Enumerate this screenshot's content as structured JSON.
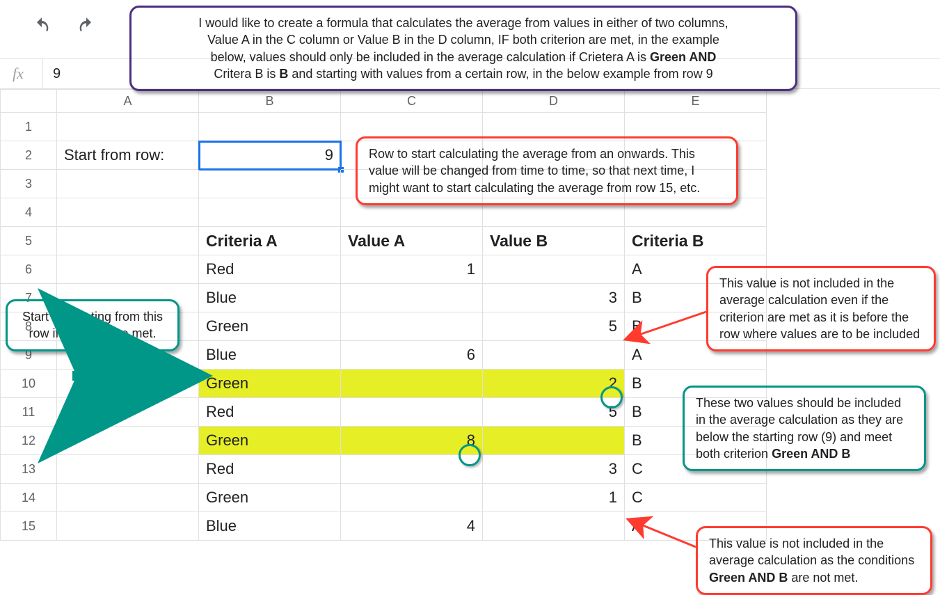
{
  "toolbar": {
    "undo_name": "undo-icon",
    "redo_name": "redo-icon"
  },
  "formula_bar": {
    "fx_label": "fx",
    "value": "9"
  },
  "columns": [
    "A",
    "B",
    "C",
    "D",
    "E"
  ],
  "row_numbers": [
    "1",
    "2",
    "3",
    "4",
    "5",
    "6",
    "7",
    "8",
    "9",
    "10",
    "11",
    "12",
    "13",
    "14",
    "15"
  ],
  "start_row_label": "Start from row:",
  "start_row_value": "9",
  "headers": {
    "critA": "Criteria A",
    "valA": "Value A",
    "valB": "Value B",
    "critB": "Criteria B"
  },
  "rows": [
    {
      "critA": "Red",
      "valA": "1",
      "valB": "",
      "critB": "A",
      "hl": false
    },
    {
      "critA": "Blue",
      "valA": "",
      "valB": "3",
      "critB": "B",
      "hl": false
    },
    {
      "critA": "Green",
      "valA": "",
      "valB": "5",
      "critB": "B",
      "hl": false
    },
    {
      "critA": "Blue",
      "valA": "6",
      "valB": "",
      "critB": "A",
      "hl": false
    },
    {
      "critA": "Green",
      "valA": "",
      "valB": "2",
      "critB": "B",
      "hl": true
    },
    {
      "critA": "Red",
      "valA": "",
      "valB": "5",
      "critB": "B",
      "hl": false
    },
    {
      "critA": "Green",
      "valA": "8",
      "valB": "",
      "critB": "B",
      "hl": true
    },
    {
      "critA": "Red",
      "valA": "",
      "valB": "3",
      "critB": "C",
      "hl": false
    },
    {
      "critA": "Green",
      "valA": "",
      "valB": "1",
      "critB": "C",
      "hl": false
    },
    {
      "critA": "Blue",
      "valA": "4",
      "valB": "",
      "critB": "A",
      "hl": false
    }
  ],
  "callouts": {
    "top": {
      "l1": "I would like to create a formula that calculates the average from values in either of two columns,",
      "l2": "Value A in the C column or Value B in the D column, IF both criterion are met, in the example",
      "l3a": "below, values should only be included in the average calculation if Crietera A is ",
      "l3b": "Green AND",
      "l4a": "Critera B is ",
      "l4b": "B",
      "l4c": " and starting with values from a certain row, in the below example from row 9"
    },
    "startDesc": {
      "l1": "Row to start calculating the average from an onwards. This",
      "l2": "value will be changed from time to time, so that next time, I",
      "l3": "might want to start calculating the average from row 15, etc."
    },
    "leftTeal": {
      "l1": "Start calculating from this",
      "l2": "row if criterion are met."
    },
    "topRightRed": {
      "l1": "This value is not included in the",
      "l2": "average calculation even if the",
      "l3": "criterion are met as it is before the",
      "l4": "row where values are to be included"
    },
    "midTeal": {
      "l1": "These two values should be included",
      "l2": "in the average calculation as they are",
      "l3": "below the starting row (9) and meet",
      "l4a": "both criterion ",
      "l4b": "Green AND B"
    },
    "bottomRed": {
      "l1": "This value is not included in the",
      "l2": "average calculation as the conditions",
      "l3a": "Green AND B",
      "l3b": " are not met."
    }
  }
}
